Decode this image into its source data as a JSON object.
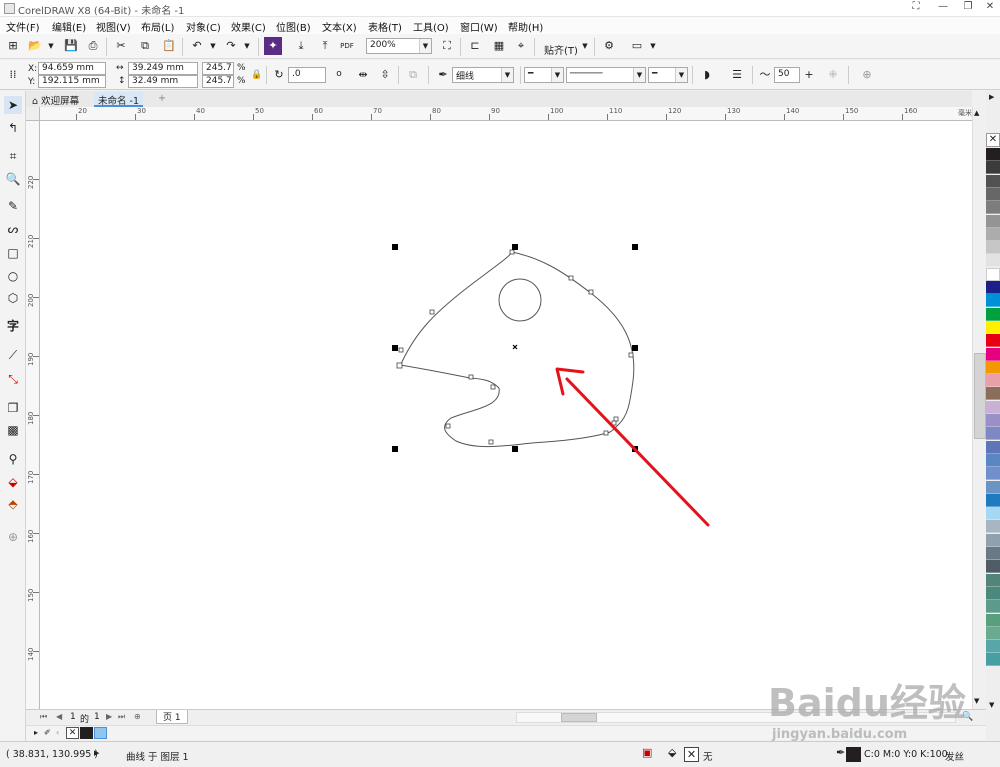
{
  "window": {
    "title": "CorelDRAW X8 (64-Bit) - 未命名 -1"
  },
  "menu": [
    "文件(F)",
    "编辑(E)",
    "视图(V)",
    "布局(L)",
    "对象(C)",
    "效果(C)",
    "位图(B)",
    "文本(X)",
    "表格(T)",
    "工具(O)",
    "窗口(W)",
    "帮助(H)"
  ],
  "toolbar": {
    "zoom": "200%",
    "pdf_label": "PDF",
    "snap_label": "贴齐(T)"
  },
  "properties": {
    "x_label": "X:",
    "x": "94.659 mm",
    "y_label": "Y:",
    "y": "192.115 mm",
    "width": "39.249 mm",
    "height": "32.49 mm",
    "scale_x": "245.7",
    "scale_y": "245.7",
    "pct": "%",
    "rotation": ".0",
    "outline": "细线",
    "smoothing": "50"
  },
  "tabs": {
    "welcome": "欢迎屏幕",
    "document": "未命名 -1",
    "add": "+"
  },
  "ruler": {
    "h_ticks": [
      "20",
      "30",
      "40",
      "50",
      "60",
      "70",
      "80",
      "90",
      "100",
      "110",
      "120",
      "130",
      "140",
      "150",
      "160"
    ],
    "unit": "毫米",
    "v_ticks": [
      "220",
      "210",
      "200",
      "190",
      "180",
      "170",
      "160",
      "150",
      "140"
    ]
  },
  "page_nav": {
    "current": "1",
    "of": "的",
    "total": "1",
    "page_tab": "页 1"
  },
  "status": {
    "coords": "( 38.831, 130.995 )",
    "object": "曲线 于 图层 1",
    "fill_none": "无",
    "outline_color": "C:0 M:0 Y:0 K:100",
    "outline_width": "发丝"
  },
  "watermark": {
    "brand": "Baidu经验",
    "url": "jingyan.baidu.com"
  },
  "icons": [
    "pointer-icon",
    "shape-icon",
    "crop-icon",
    "zoom-icon",
    "freehand-icon",
    "artistic-media-icon",
    "rectangle-icon",
    "ellipse-icon",
    "polygon-icon",
    "text-icon",
    "parallel-dimension-icon",
    "connector-icon",
    "drop-shadow-icon",
    "transparency-icon",
    "eyedropper-icon",
    "interactive-fill-icon",
    "smart-fill-icon",
    "add-tool-icon"
  ],
  "colors": {
    "arrow": "#e3131b",
    "palette": [
      "#231f20",
      "#3b3b3b",
      "#525252",
      "#676767",
      "#7d7d7d",
      "#949494",
      "#acacac",
      "#c6c6c6",
      "#e2e2e2",
      "#ffffff",
      "#1d2088",
      "#0090d8",
      "#00a040",
      "#fff000",
      "#e60012",
      "#e4007f",
      "#f39800",
      "#e9a0a8",
      "#8b6d5c",
      "#c9b1d6",
      "#9a90c8",
      "#7e89c3",
      "#6075b8",
      "#5a86c3",
      "#708fcc",
      "#6a94c3",
      "#1e7bbf",
      "#a6d8f3",
      "#a8b6c3",
      "#8fa1af",
      "#697a86",
      "#505d66",
      "#53847a",
      "#4a8a7e",
      "#5c9a8b",
      "#5a9f7d",
      "#6aaa90",
      "#58a6a8",
      "#46a0a3"
    ]
  }
}
